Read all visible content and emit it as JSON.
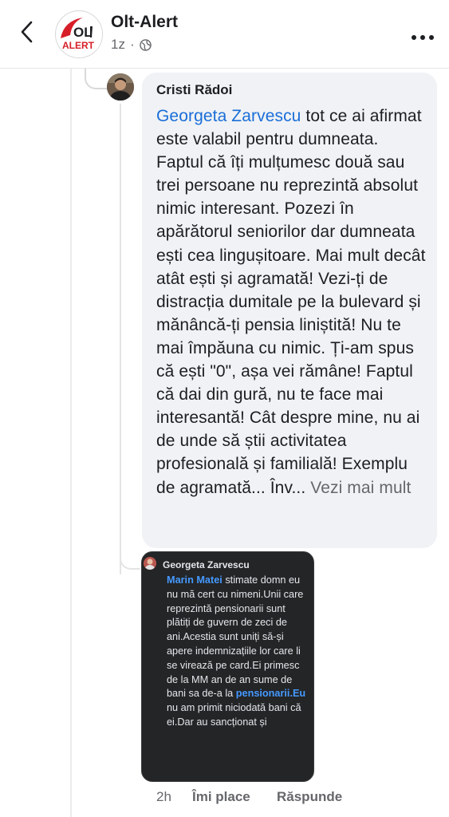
{
  "header": {
    "page_name": "Olt-Alert",
    "time": "1z",
    "separator": "·",
    "logo_text": "OLT ALERT"
  },
  "comment": {
    "author": "Cristi Rădoi",
    "mention": "Georgeta Zarvescu",
    "text": " tot ce ai afirmat este valabil pentru dumneata. Faptul că îți mulțumesc două sau trei persoane nu reprezintă absolut nimic interesant. Pozezi în apărătorul seniorilor dar dumneata ești cea lingușitoare. Mai mult decât atât ești și agramată! Vezi-ți de distracția dumitale pe la bulevard și mănâncă-ți pensia liniștită! Nu te mai împăuna cu nimic. Ți-am spus că ești \"0\", așa vei rămâne! Faptul că dai din gură, nu te face mai interesantă! Cât despre mine, nu ai de unde să știi activitatea profesională și familială! Exemplu de agramată... Înv... ",
    "see_more": "Vezi mai mult"
  },
  "attachment": {
    "author": "Georgeta Zarvescu",
    "mention": "Marin Matei",
    "text_1": " stimate domn eu nu mă cert cu nimeni.Unii care reprezintă pensionarii sunt plătiți de guvern de zeci de ani.Acestia sunt uniți să-și apere indemnizațiile lor care li se virează pe card.Ei primesc de la MM an de an sume de bani sa de-a la ",
    "link": "pensionarii.Eu",
    "text_2": " nu am primit niciodată bani că ei.Dar au sancționat și"
  },
  "actions": {
    "time": "2h",
    "like": "Îmi place",
    "reply": "Răspunde"
  }
}
